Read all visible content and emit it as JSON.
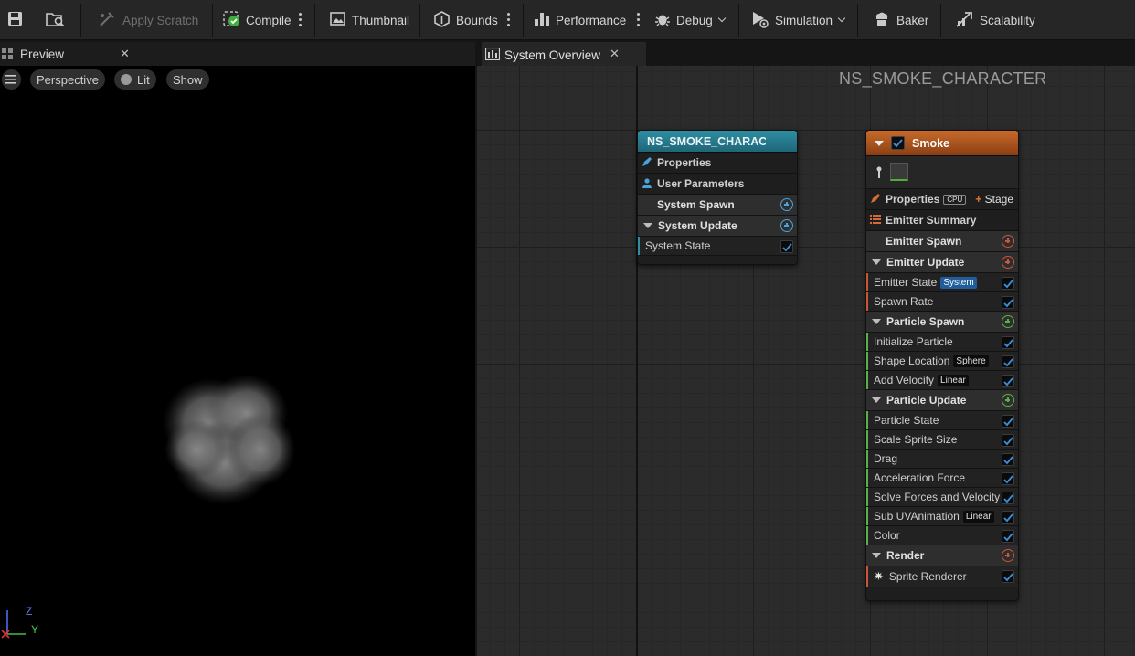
{
  "toolbar": {
    "apply_scratch": "Apply Scratch",
    "compile": "Compile",
    "thumbnail": "Thumbnail",
    "bounds": "Bounds",
    "performance": "Performance",
    "debug": "Debug",
    "simulation": "Simulation",
    "baker": "Baker",
    "scalability": "Scalability"
  },
  "preview": {
    "tab_title": "Preview",
    "view_mode": "Perspective",
    "lighting": "Lit",
    "show": "Show",
    "axis_z": "Z",
    "axis_y": "Y"
  },
  "graph": {
    "tab_title": "System Overview",
    "system_name": "NS_SMOKE_CHARACTER",
    "system_node": {
      "title": "NS_SMOKE_CHARACT",
      "properties": "Properties",
      "user_parameters": "User Parameters",
      "system_spawn": "System Spawn",
      "system_update": "System Update",
      "system_state": "System State"
    },
    "emitter_node": {
      "title": "Smoke",
      "properties": "Properties",
      "cpu_tag": "CPU",
      "stage": "Stage",
      "emitter_summary": "Emitter Summary",
      "emitter_spawn": "Emitter Spawn",
      "emitter_update": "Emitter Update",
      "emitter_state": "Emitter State",
      "emitter_state_tag": "System",
      "spawn_rate": "Spawn Rate",
      "particle_spawn": "Particle Spawn",
      "initialize_particle": "Initialize Particle",
      "shape_location": "Shape Location",
      "shape_location_tag": "Sphere",
      "add_velocity": "Add Velocity",
      "add_velocity_tag": "Linear",
      "particle_update": "Particle Update",
      "particle_state": "Particle State",
      "scale_sprite_size": "Scale Sprite Size",
      "drag": "Drag",
      "acceleration_force": "Acceleration Force",
      "solve_forces": "Solve Forces and Velocity",
      "sub_uv": "Sub UVAnimation",
      "sub_uv_tag": "Linear",
      "color": "Color",
      "render": "Render",
      "sprite_renderer": "Sprite Renderer"
    }
  },
  "colors": {
    "system_header": "#2a7f92",
    "emitter_header": "#b35a22",
    "checkbox_blue": "#3a8fe0"
  }
}
